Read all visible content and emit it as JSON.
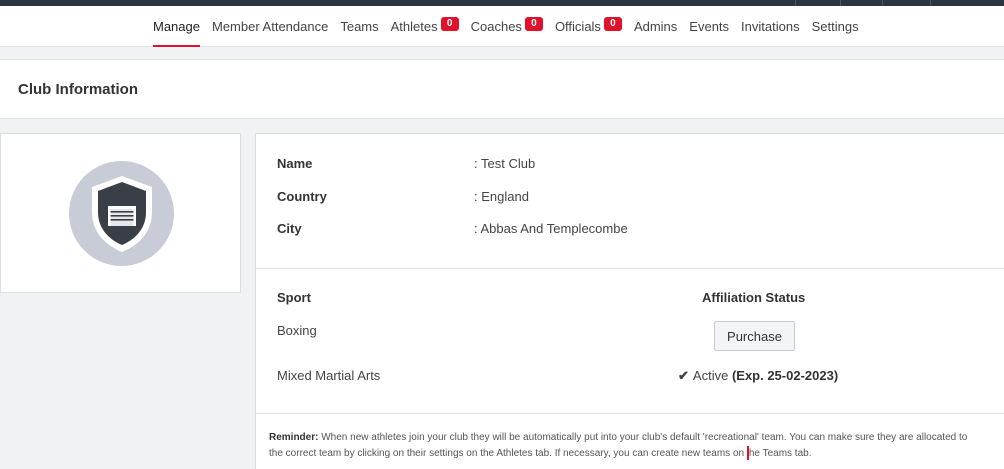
{
  "nav": {
    "items": [
      {
        "label": "Manage",
        "badge": null,
        "active": true
      },
      {
        "label": "Member Attendance",
        "badge": null,
        "active": false
      },
      {
        "label": "Teams",
        "badge": null,
        "active": false
      },
      {
        "label": "Athletes",
        "badge": "0",
        "active": false
      },
      {
        "label": "Coaches",
        "badge": "0",
        "active": false
      },
      {
        "label": "Officials",
        "badge": "0",
        "active": false
      },
      {
        "label": "Admins",
        "badge": null,
        "active": false
      },
      {
        "label": "Events",
        "badge": null,
        "active": false
      },
      {
        "label": "Invitations",
        "badge": null,
        "active": false
      },
      {
        "label": "Settings",
        "badge": null,
        "active": false
      }
    ],
    "accent_color": "#e0112b"
  },
  "club_info": {
    "title": "Club Information",
    "fields": [
      {
        "label": "Name",
        "value": ": Test Club"
      },
      {
        "label": "Country",
        "value": ": England"
      },
      {
        "label": "City",
        "value": ": Abbas And Templecombe"
      }
    ],
    "logo_icon": "shield-boxing-ring-icon"
  },
  "sports": {
    "sport_header": "Sport",
    "affiliation_header": "Affiliation Status",
    "rows": [
      {
        "sport": "Boxing",
        "action_label": "Purchase"
      },
      {
        "sport": "Mixed Martial Arts",
        "status": "Active",
        "expiry": "(Exp. 25-02-2023)"
      }
    ]
  },
  "reminder": {
    "label": "Reminder:",
    "text_before_cursor": "When new athletes join your club they will be automatically put into your club's default 'recreational' team. You can make sure they are allocated to the correct team by clicking on their settings on the Athletes tab. If necessary, you can create new teams on ",
    "text_after_cursor": "he Teams tab."
  }
}
